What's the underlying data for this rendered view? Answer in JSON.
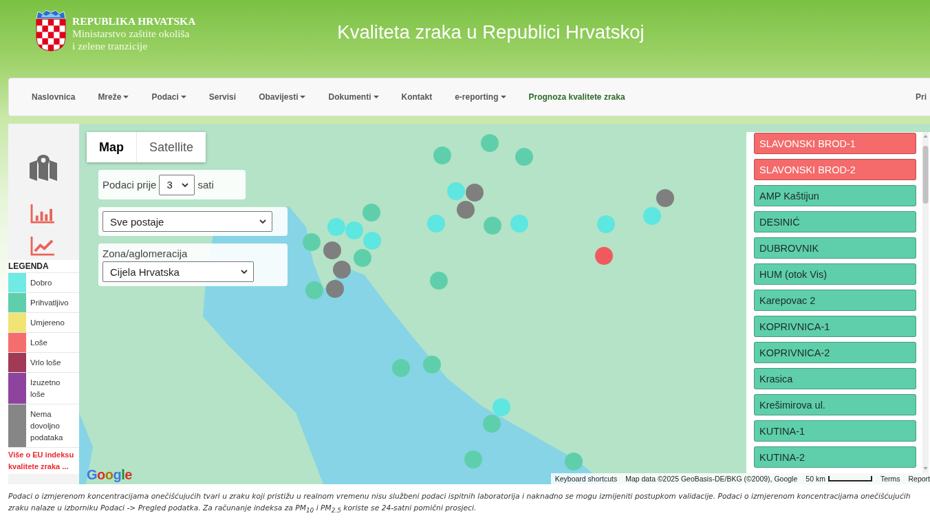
{
  "header": {
    "org_name": "REPUBLIKA HRVATSKA",
    "ministry_lines": [
      "Ministarstvo zaštite okoliša",
      "i zelene tranzicije"
    ],
    "title": "Kvaliteta zraka u Republici Hrvatskoj"
  },
  "nav": {
    "items": [
      {
        "label": "Naslovnica",
        "dropdown": false,
        "selected": false
      },
      {
        "label": "Mreže",
        "dropdown": true,
        "selected": false
      },
      {
        "label": "Podaci",
        "dropdown": true,
        "selected": false
      },
      {
        "label": "Servisi",
        "dropdown": false,
        "selected": false
      },
      {
        "label": "Obavijesti",
        "dropdown": true,
        "selected": false
      },
      {
        "label": "Dokumenti",
        "dropdown": true,
        "selected": false
      },
      {
        "label": "Kontakt",
        "dropdown": false,
        "selected": false
      },
      {
        "label": "e-reporting",
        "dropdown": true,
        "selected": false
      },
      {
        "label": "Prognoza kvalitete zraka",
        "dropdown": false,
        "selected": true
      }
    ],
    "right_label": "Pri"
  },
  "legend": {
    "title": "LEGENDA",
    "items": [
      {
        "label": "Dobro",
        "color": "#70eae5"
      },
      {
        "label": "Prihvatljivo",
        "color": "#5fcfab"
      },
      {
        "label": "Umjereno",
        "color": "#f0e474"
      },
      {
        "label": "Loše",
        "color": "#f56e6e"
      },
      {
        "label": "Vrlo loše",
        "color": "#a03a55"
      },
      {
        "label": "Izuzetno loše",
        "color": "#8e449e"
      },
      {
        "label": "Nema dovoljno podataka",
        "color": "#868686"
      }
    ],
    "link": "Više o EU indeksu kvalitete zraka ..."
  },
  "map": {
    "type_tabs": [
      {
        "label": "Map",
        "selected": true
      },
      {
        "label": "Satellite",
        "selected": false
      }
    ],
    "hours_filter": {
      "label": "Podaci prije",
      "value": "3",
      "unit": "sati"
    },
    "station_filter": {
      "value": "Sve postaje"
    },
    "zone_filter": {
      "label": "Zona/aglomeracija",
      "value": "Cijela Hrvatska"
    },
    "markers": [
      {
        "color": "#5fcfab"
      },
      {
        "color": "#5fcfab"
      },
      {
        "color": "#5fcfab"
      },
      {
        "color": "#5ee6e0"
      },
      {
        "color": "#7f7f7f"
      },
      {
        "color": "#7f7f7f"
      },
      {
        "color": "#5ee6e0"
      },
      {
        "color": "#5fcfab"
      },
      {
        "color": "#5ee6e0"
      },
      {
        "color": "#5ee6e0"
      },
      {
        "color": "#5ee6e0"
      },
      {
        "color": "#7f7f7f"
      },
      {
        "color": "#f05a5e"
      },
      {
        "color": "#5fcfab"
      },
      {
        "color": "#5ee6e0"
      },
      {
        "color": "#5ee6e0"
      },
      {
        "color": "#5fcfab"
      },
      {
        "color": "#5fcfab"
      },
      {
        "color": "#7f7f7f"
      },
      {
        "color": "#7f7f7f"
      },
      {
        "color": "#7f7f7f"
      },
      {
        "color": "#5fcfab"
      },
      {
        "color": "#5fcfab"
      },
      {
        "color": "#5fcfab"
      },
      {
        "color": "#5fcfab"
      },
      {
        "color": "#5ee6e0"
      },
      {
        "color": "#5ee6e0"
      },
      {
        "color": "#5fcfab"
      },
      {
        "color": "#5fcfab"
      },
      {
        "color": "#5fcfab"
      }
    ],
    "logo": "Google",
    "shortcuts": "Keyboard shortcuts",
    "attribution": "Map data ©2025 GeoBasis-DE/BKG (©2009), Google",
    "scale": "50 km",
    "links": [
      "Terms",
      "Report"
    ]
  },
  "stations": [
    {
      "name": "SLAVONSKI BROD-1",
      "color": "#f56a6a"
    },
    {
      "name": "SLAVONSKI BROD-2",
      "color": "#f56a6a"
    },
    {
      "name": "AMP Kaštijun",
      "color": "#5ecfaa"
    },
    {
      "name": "DESINIĆ",
      "color": "#5ecfaa"
    },
    {
      "name": "DUBROVNIK",
      "color": "#5ecfaa"
    },
    {
      "name": "HUM (otok Vis)",
      "color": "#5ecfaa"
    },
    {
      "name": "Karepovac 2",
      "color": "#5ecfaa"
    },
    {
      "name": "KOPRIVNICA-1",
      "color": "#5ecfaa"
    },
    {
      "name": "KOPRIVNICA-2",
      "color": "#5ecfaa"
    },
    {
      "name": "Krasica",
      "color": "#5ecfaa"
    },
    {
      "name": "Krešimirova ul.",
      "color": "#5ecfaa"
    },
    {
      "name": "KUTINA-1",
      "color": "#5ecfaa"
    },
    {
      "name": "KUTINA-2",
      "color": "#5ecfaa"
    }
  ],
  "footer": {
    "lines": [
      "Podaci o izmjerenom koncentracijama onečišćujućih tvari u zraku koji pristižu u realnom vremenu nisu službeni podaci ispitnih laboratorija i naknadno se mogu izmijeniti postupkom validacije. Podaci o izmjerenom koncentracijama onečišćujućih",
      "zraku nalaze u izborniku Podaci -> Pregled podatka. Za računanje indeksa za PM$_{10}$ i PM$_{2.5}$ koriste se 24-satni pomični prosjeci."
    ]
  }
}
